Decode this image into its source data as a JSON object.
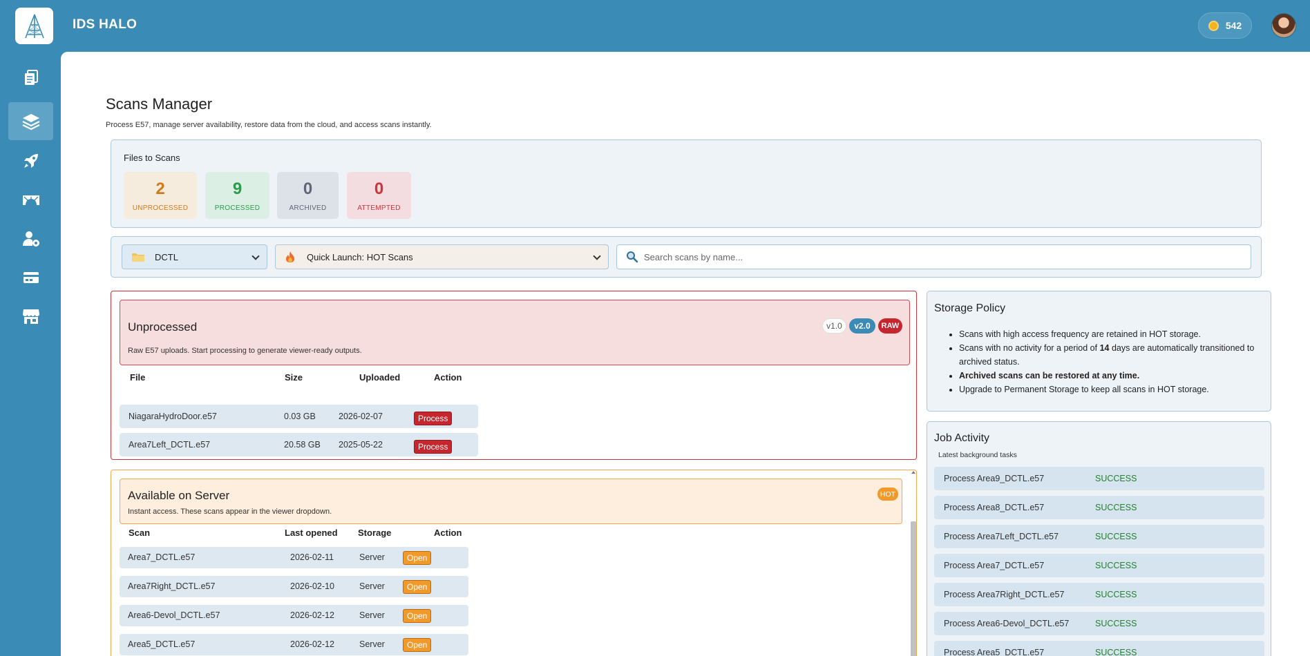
{
  "app": {
    "title": "IDS HALO",
    "credits": "542"
  },
  "page": {
    "title": "Scans Manager",
    "subtitle": "Process E57, manage server availability, restore data from the cloud, and access scans instantly."
  },
  "files": {
    "label": "Files to Scans",
    "stats": [
      {
        "value": "2",
        "label": "UNPROCESSED",
        "color": "#d07a1d",
        "bg": "#f5ecdd"
      },
      {
        "value": "9",
        "label": "PROCESSED",
        "color": "#2b9a4a",
        "bg": "#dcefe4"
      },
      {
        "value": "0",
        "label": "ARCHIVED",
        "color": "#5e6677",
        "bg": "#dde2e9"
      },
      {
        "value": "0",
        "label": "ATTEMPTED",
        "color": "#d0333b",
        "bg": "#f4dde0"
      }
    ]
  },
  "filters": {
    "folder": "DCTL",
    "quick_launch": "Quick Launch: HOT Scans",
    "search_placeholder": "Search scans by name..."
  },
  "unprocessed": {
    "title": "Unprocessed",
    "subtitle": "Raw E57 uploads. Start processing to generate viewer-ready outputs.",
    "badges": [
      "v1.0",
      "v2.0",
      "RAW"
    ],
    "headers": [
      "File",
      "Size",
      "Uploaded",
      "Action"
    ],
    "rows": [
      {
        "file": "NiagaraHydroDoor.e57",
        "size": "0.03 GB",
        "uploaded": "2026-02-07",
        "action": "Process"
      },
      {
        "file": "Area7Left_DCTL.e57",
        "size": "20.58 GB",
        "uploaded": "2025-05-22",
        "action": "Process"
      }
    ]
  },
  "available": {
    "title": "Available on Server",
    "subtitle": "Instant access. These scans appear in the viewer dropdown.",
    "badge": "HOT",
    "headers": [
      "Scan",
      "Last opened",
      "Storage",
      "Action"
    ],
    "rows": [
      {
        "scan": "Area7_DCTL.e57",
        "opened": "2026-02-11",
        "storage": "Server",
        "action": "Open"
      },
      {
        "scan": "Area7Right_DCTL.e57",
        "opened": "2026-02-10",
        "storage": "Server",
        "action": "Open"
      },
      {
        "scan": "Area6-Devol_DCTL.e57",
        "opened": "2026-02-12",
        "storage": "Server",
        "action": "Open"
      },
      {
        "scan": "Area5_DCTL.e57",
        "opened": "2026-02-12",
        "storage": "Server",
        "action": "Open"
      }
    ]
  },
  "policy": {
    "title": "Storage Policy",
    "item1": "Scans with high access frequency are retained in HOT storage.",
    "item2_pre": "Scans with no activity for a period of ",
    "item2_days": "14",
    "item2_post": " days are automatically transitioned to archived status.",
    "item3": "Archived scans can be restored at any time.",
    "item4": "Upgrade to Permanent Storage to keep all scans in HOT storage."
  },
  "jobs": {
    "title": "Job Activity",
    "subtitle": "Latest background tasks",
    "rows": [
      {
        "name": "Process Area9_DCTL.e57",
        "status": "SUCCESS"
      },
      {
        "name": "Process Area8_DCTL.e57",
        "status": "SUCCESS"
      },
      {
        "name": "Process Area7Left_DCTL.e57",
        "status": "SUCCESS"
      },
      {
        "name": "Process Area7_DCTL.e57",
        "status": "SUCCESS"
      },
      {
        "name": "Process Area7Right_DCTL.e57",
        "status": "SUCCESS"
      },
      {
        "name": "Process Area6-Devol_DCTL.e57",
        "status": "SUCCESS"
      },
      {
        "name": "Process Area5_DCTL.e57",
        "status": "SUCCESS"
      }
    ]
  },
  "icons": {
    "sidebar": [
      "documents-icon",
      "layers-icon",
      "rocket-icon",
      "bridge-icon",
      "user-settings-icon",
      "billing-icon",
      "store-icon"
    ]
  }
}
